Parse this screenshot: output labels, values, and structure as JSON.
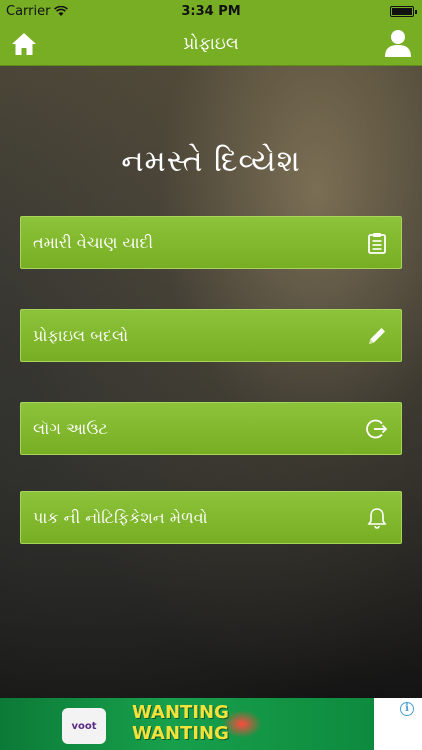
{
  "status_bar": {
    "carrier": "Carrier",
    "time": "3:34 PM"
  },
  "nav": {
    "title": "પ્રોફાઇલ",
    "left_icon": "home-icon",
    "right_icon": "user-icon"
  },
  "greeting": "નમસ્તે દિવ્યેશ",
  "menu": [
    {
      "label": "તમારી વેચાણ યાદી",
      "icon": "clipboard-icon"
    },
    {
      "label": "પ્રોફાઇલ બદલો",
      "icon": "pencil-icon"
    },
    {
      "label": "લૉગ આઉટ",
      "icon": "logout-icon"
    },
    {
      "label": "પાક ની નોટિફિકેશન મેળવો",
      "icon": "bell-icon"
    }
  ],
  "ad": {
    "brand": "voot",
    "headline_1": "WANTING",
    "headline_2": "WANTING",
    "info": "i"
  },
  "colors": {
    "accent": "#78ae23",
    "button": "#8cc33a"
  }
}
